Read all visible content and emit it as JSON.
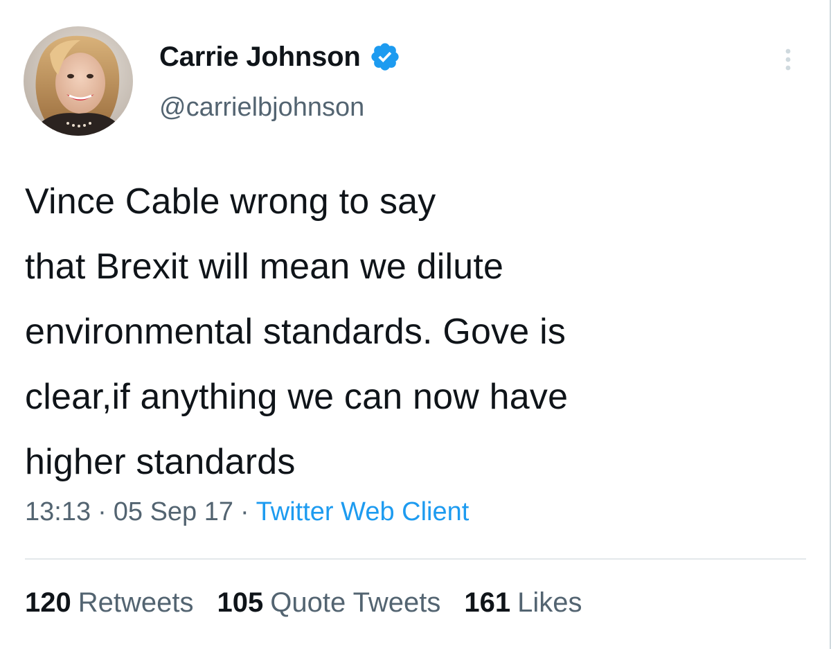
{
  "colors": {
    "verified_badge": "#1d9bf0",
    "link": "#1d9bf0",
    "secondary_text": "#536471",
    "primary_text": "#0f1419"
  },
  "author": {
    "display_name": "Carrie Johnson",
    "handle": "@carrielbjohnson",
    "verified": true,
    "avatar_icon": "profile-photo"
  },
  "tweet": {
    "text_lines": [
      "Vince Cable wrong to say",
      "that Brexit will mean we dilute",
      "environmental standards. Gove is",
      "clear,if anything we can now have",
      "higher standards"
    ],
    "time": "13:13",
    "date": "05 Sep 17",
    "separator": "·",
    "source": "Twitter Web Client"
  },
  "stats": {
    "retweets_count": "120",
    "retweets_label": "Retweets",
    "quote_tweets_count": "105",
    "quote_tweets_label": "Quote Tweets",
    "likes_count": "161",
    "likes_label": "Likes"
  },
  "icons": {
    "more": "more-vertical-icon",
    "verified": "verified-badge-icon"
  }
}
